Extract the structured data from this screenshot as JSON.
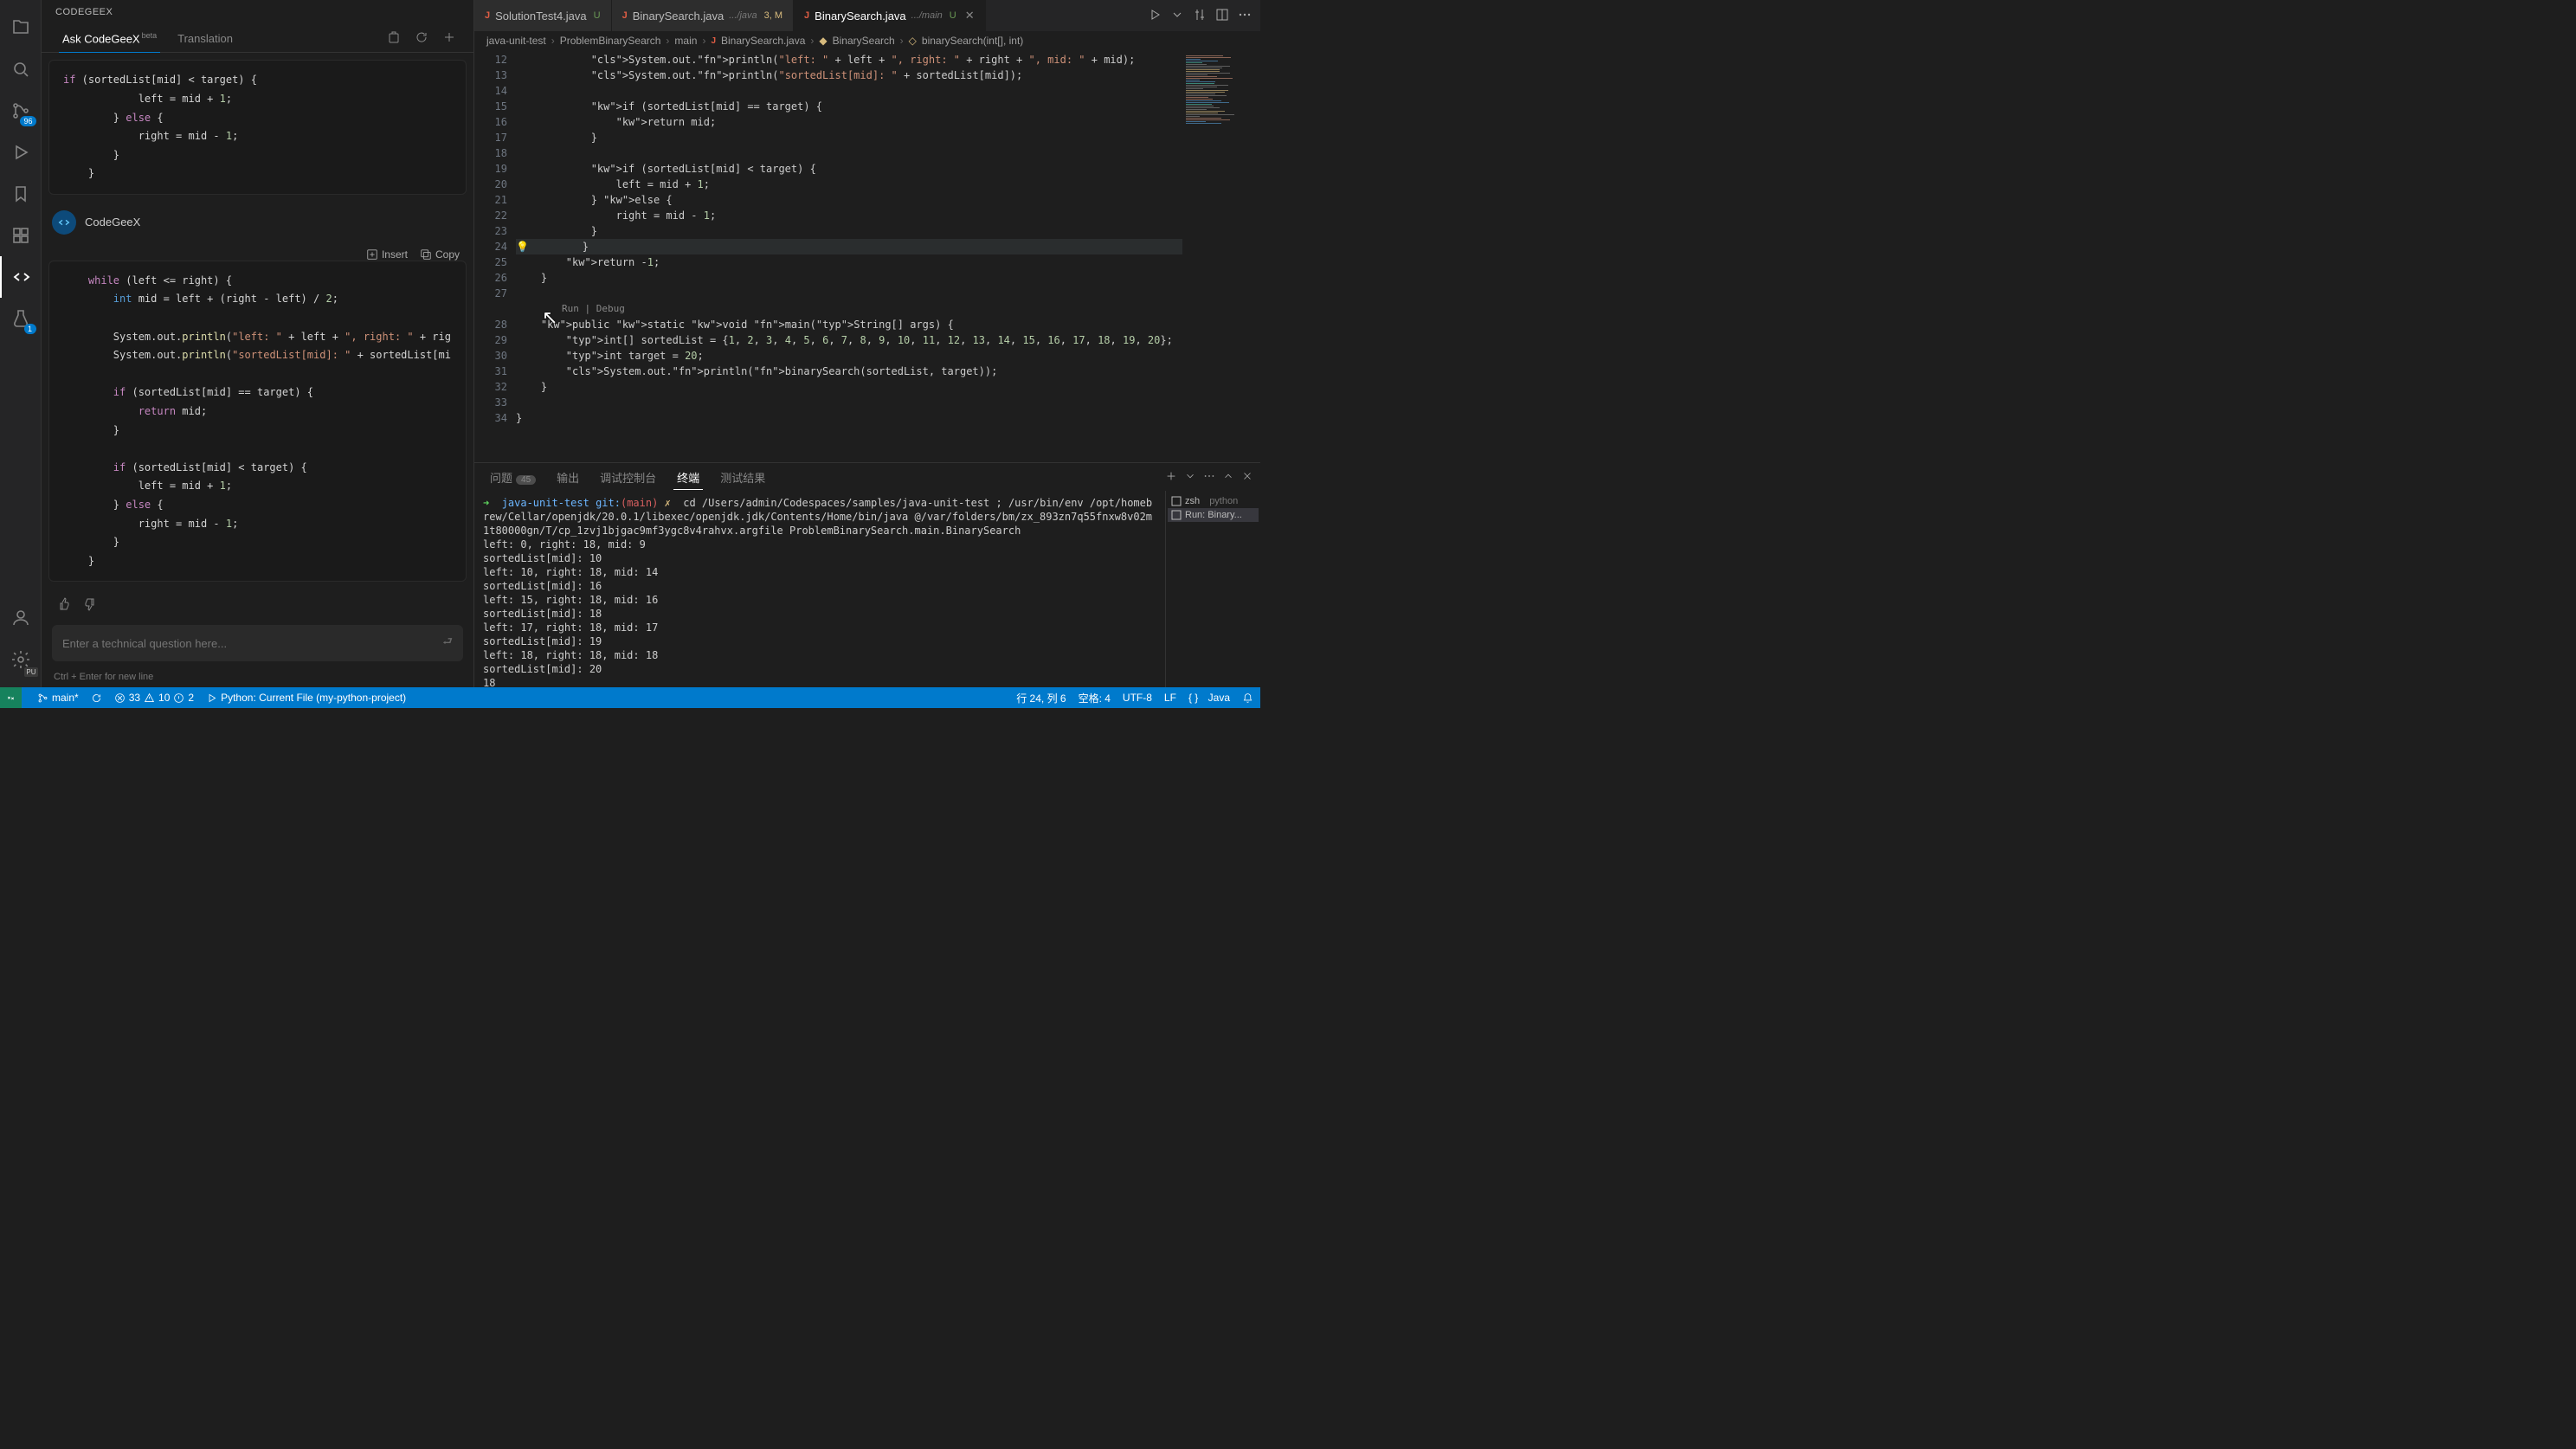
{
  "sidebar_title": "CODEGEEX",
  "sidebar": {
    "tab_ask": "Ask CodeGeeX",
    "tab_ask_sup": "beta",
    "tab_translate": "Translation"
  },
  "chat": {
    "bot_name": "CodeGeeX",
    "insert": "Insert",
    "copy": "Copy",
    "input_placeholder": "Enter a technical question here...",
    "hint": "Ctrl + Enter for new line"
  },
  "activity_badges": {
    "scm": "96",
    "test": "1"
  },
  "pu_label": "PU",
  "tabs": [
    {
      "name": "SolutionTest4.java",
      "status": "U"
    },
    {
      "name": "BinarySearch.java",
      "desc": ".../java",
      "extra": "3, M"
    },
    {
      "name": "BinarySearch.java",
      "desc": ".../main",
      "status": "U"
    }
  ],
  "breadcrumb": {
    "p1": "java-unit-test",
    "p2": "ProblemBinarySearch",
    "p3": "main",
    "p4": "BinarySearch.java",
    "p5": "BinarySearch",
    "p6": "binarySearch(int[], int)"
  },
  "codelens": {
    "run": "Run",
    "debug": "Debug"
  },
  "editor_lines": {
    "start": 12,
    "code": [
      "            System.out.println(\"left: \" + left + \", right: \" + right + \", mid: \" + mid);",
      "            System.out.println(\"sortedList[mid]: \" + sortedList[mid]);",
      "",
      "            if (sortedList[mid] == target) {",
      "                return mid;",
      "            }",
      "",
      "            if (sortedList[mid] < target) {",
      "                left = mid + 1;",
      "            } else {",
      "                right = mid - 1;",
      "            }",
      "        }",
      "        return -1;",
      "    }",
      "",
      "    public static void main(String[] args) {",
      "        int[] sortedList = {1, 2, 3, 4, 5, 6, 7, 8, 9, 10, 11, 12, 13, 14, 15, 16, 17, 18, 19, 20};",
      "        int target = 20;",
      "        System.out.println(binarySearch(sortedList, target));",
      "    }",
      "",
      "}"
    ]
  },
  "chat_code1": "        if (sortedList[mid] < target) {\n            left = mid + 1;\n        } else {\n            right = mid - 1;\n        }\n    }",
  "chat_code2": "    while (left <= right) {\n        int mid = left + (right - left) / 2;\n\n        System.out.println(\"left: \" + left + \", right: \" + rig\n        System.out.println(\"sortedList[mid]: \" + sortedList[mi\n\n        if (sortedList[mid] == target) {\n            return mid;\n        }\n\n        if (sortedList[mid] < target) {\n            left = mid + 1;\n        } else {\n            right = mid - 1;\n        }\n    }",
  "panel": {
    "problems": "问题",
    "problems_count": "45",
    "output": "输出",
    "debug_console": "调试控制台",
    "terminal": "终端",
    "test_results": "测试结果"
  },
  "terminal_prompt": {
    "path": "java-unit-test",
    "git": "git:",
    "branch": "(main)",
    "x": "✗"
  },
  "terminal_cmd": "cd /Users/admin/Codespaces/samples/java-unit-test ; /usr/bin/env /opt/homebrew/Cellar/openjdk/20.0.1/libexec/openjdk.jdk/Contents/Home/bin/java @/var/folders/bm/zx_893zn7q55fnxw8v02m1t80000gn/T/cp_1zvj1bjgac9mf3ygc8v4rahvx.argfile ProblemBinarySearch.main.BinarySearch",
  "terminal_out": [
    "left: 0, right: 18, mid: 9",
    "sortedList[mid]: 10",
    "left: 10, right: 18, mid: 14",
    "sortedList[mid]: 16",
    "left: 15, right: 18, mid: 16",
    "sortedList[mid]: 18",
    "left: 17, right: 18, mid: 17",
    "sortedList[mid]: 19",
    "left: 18, right: 18, mid: 18",
    "sortedList[mid]: 20",
    "18"
  ],
  "term_side": {
    "zsh": "zsh",
    "zsh_desc": "python",
    "run": "Run: Binary..."
  },
  "status": {
    "branch": "main*",
    "sync": "",
    "err_a": "33",
    "err_b": "10",
    "err_c": "2",
    "python": "Python: Current File (my-python-project)",
    "cursor": "行 24, 列 6",
    "spaces": "空格: 4",
    "encoding": "UTF-8",
    "eol": "LF",
    "lang": "Java",
    "bell": ""
  }
}
